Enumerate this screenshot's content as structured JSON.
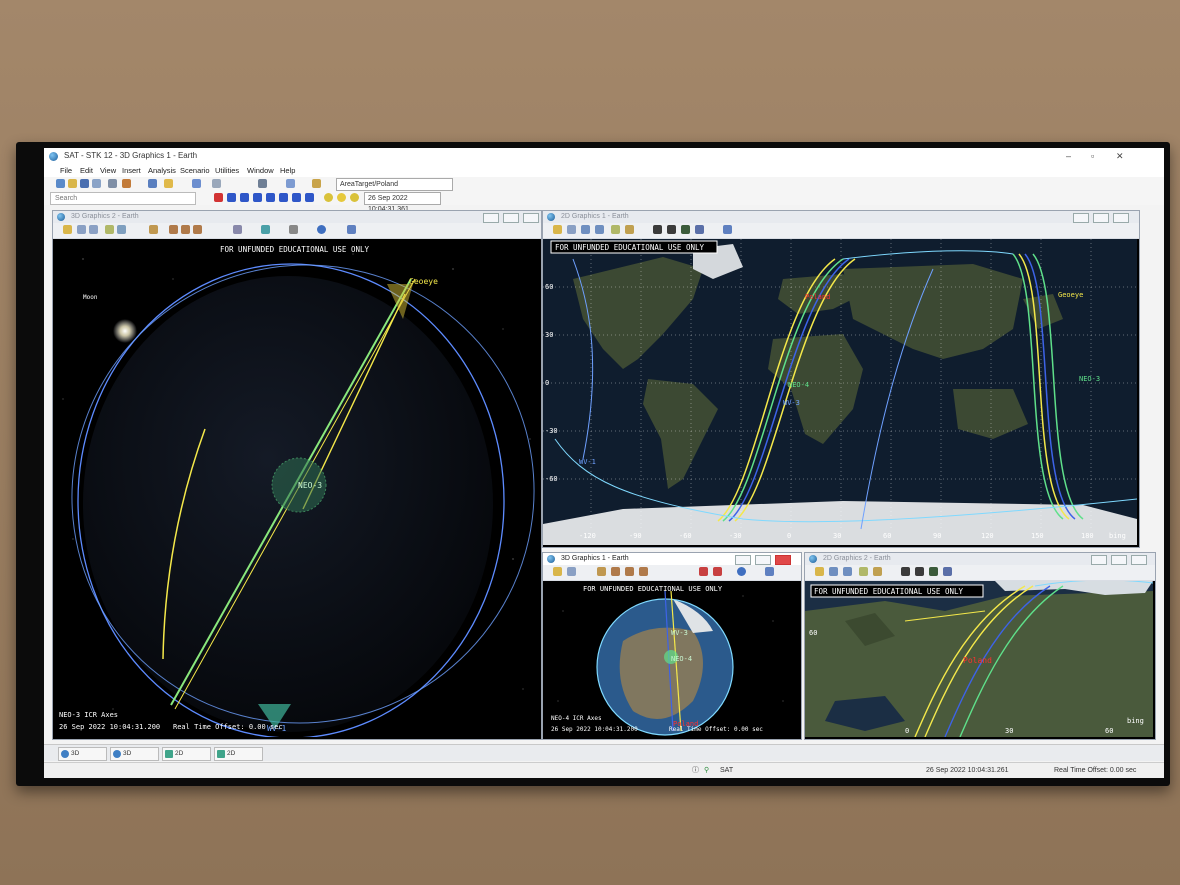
{
  "window": {
    "title": "SAT - STK 12 - 3D Graphics 1 - Earth"
  },
  "menu": [
    "File",
    "Edit",
    "View",
    "Insert",
    "Analysis",
    "Scenario",
    "Utilities",
    "Window",
    "Help"
  ],
  "toolbar": {
    "search_placeholder": "Search",
    "target_select": "AreaTarget/Poland",
    "time": "26 Sep 2022 10:04:31.361"
  },
  "panes": {
    "left": {
      "title": "3D Graphics 2 - Earth",
      "banner": "FOR UNFUNDED EDUCATIONAL USE ONLY",
      "labels": {
        "moon": "Moon",
        "geoeye": "Geoeye",
        "neo3": "NEO-3",
        "wv1": "WV-1"
      },
      "axes": "NEO-3 ICR Axes",
      "time": "26 Sep 2022 10:04:31.200",
      "offset": "Real Time Offset: 0.00 sec"
    },
    "map": {
      "title": "2D Graphics 1 - Earth",
      "banner": "FOR UNFUNDED EDUCATIONAL USE ONLY",
      "lat_ticks": [
        "60",
        "30",
        "0",
        "-30",
        "-60"
      ],
      "lon_ticks": [
        "-120",
        "-90",
        "-60",
        "-30",
        "0",
        "30",
        "60",
        "90",
        "120",
        "150",
        "180"
      ],
      "labels": {
        "poland": "Poland",
        "geoeye": "Geoeye",
        "neo4": "NEO-4",
        "neo3": "NEO-3",
        "wv3": "WV-3",
        "wv1": "WV-1"
      },
      "bing": "bing"
    },
    "small3d": {
      "title": "3D Graphics 1 - Earth",
      "banner": "FOR UNFUNDED EDUCATIONAL USE ONLY",
      "labels": {
        "wv3": "WV-3",
        "neo4": "NEO-4",
        "poland": "Poland"
      },
      "axes": "NEO-4 ICR Axes",
      "time": "26 Sep 2022 10:04:31.200",
      "offset": "Real Time Offset: 0.00 sec"
    },
    "europe": {
      "title": "2D Graphics 2 - Earth",
      "banner": "FOR UNFUNDED EDUCATIONAL USE ONLY",
      "lat_tick": "60",
      "lon_ticks": [
        "0",
        "30",
        "60"
      ],
      "labels": {
        "poland": "Poland"
      },
      "bing": "bing"
    }
  },
  "tabs": [
    "3D Graphic...",
    "3D Graphic...",
    "2D Graphic...",
    "2D Graphic..."
  ],
  "status": {
    "scenario": "SAT",
    "time": "26 Sep 2022 10:04:31.261",
    "offset": "Real Time Offset: 0.00 sec"
  },
  "colors": {
    "yellow": "#f4e84a",
    "green": "#5fe08a",
    "cyan": "#7fd9ff",
    "blue": "#3d63e8",
    "red": "#ff3030"
  }
}
